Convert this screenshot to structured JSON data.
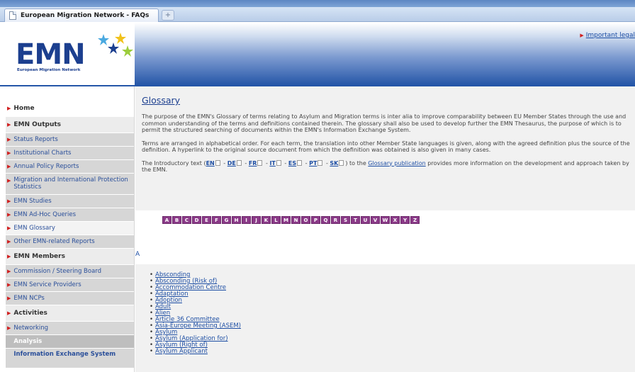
{
  "browser": {
    "tab_title": "European Migration Network - FAQs",
    "new_tab_symbol": "+"
  },
  "header": {
    "logo_text": "EMN",
    "logo_subtitle": "European Migration Network",
    "legal_link": "Important legal"
  },
  "sidebar": {
    "home": "Home",
    "outputs": {
      "label": "EMN Outputs",
      "items": [
        "Status Reports",
        "Institutional Charts",
        "Annual Policy Reports",
        "Migration and International Protection Statistics",
        "EMN Studies",
        "EMN Ad-Hoc Queries",
        "EMN Glossary",
        "Other EMN-related Reports"
      ]
    },
    "members": {
      "label": "EMN Members",
      "items": [
        "Commission / Steering Board",
        "EMN Service Providers",
        "EMN NCPs"
      ]
    },
    "activities": {
      "label": "Activities",
      "items": [
        "Networking",
        "Analysis",
        "Information Exchange System"
      ]
    }
  },
  "main": {
    "title": "Glossary",
    "para1": "The purpose of the EMN's Glossary of terms relating to Asylum and Migration terms is inter alia to improve comparability between EU Member States through the use and common understanding of the terms and definitions contained therein. The glossary shall also be used to develop further the EMN Thesaurus, the purpose of which is to permit the structured searching of documents within the EMN's Information Exchange System.",
    "para2": "Terms are arranged in alphabetical order. For each term, the translation into other Member State languages is given, along with the agreed definition plus the source of the definition. A hyperlink to the original source document from which the definition was obtained is also given in many cases.",
    "para3_start": "The Introductory text (",
    "para3_mid": ") to the ",
    "para3_link": "Glossary publication",
    "para3_end": " provides more information on the development and approach taken by the EMN.",
    "languages": [
      "EN",
      "DE",
      "FR",
      "IT",
      "ES",
      "PT",
      "SK"
    ],
    "separator": " - ",
    "alphabet": [
      "A",
      "B",
      "C",
      "D",
      "E",
      "F",
      "G",
      "H",
      "I",
      "J",
      "K",
      "L",
      "M",
      "N",
      "O",
      "P",
      "Q",
      "R",
      "S",
      "T",
      "U",
      "V",
      "W",
      "X",
      "Y",
      "Z"
    ],
    "current_letter": "A",
    "terms": [
      "Absconding",
      "Absconding (Risk of)",
      "Accommodation Centre",
      "Adaptation",
      "Adoption",
      "Adult",
      "Alien",
      "Article 36 Committee",
      "Asia-Europe Meeting (ASEM)",
      "Asylum",
      "Asylum (Application for)",
      "Asylum (Right of)",
      "Asylum Applicant"
    ]
  }
}
